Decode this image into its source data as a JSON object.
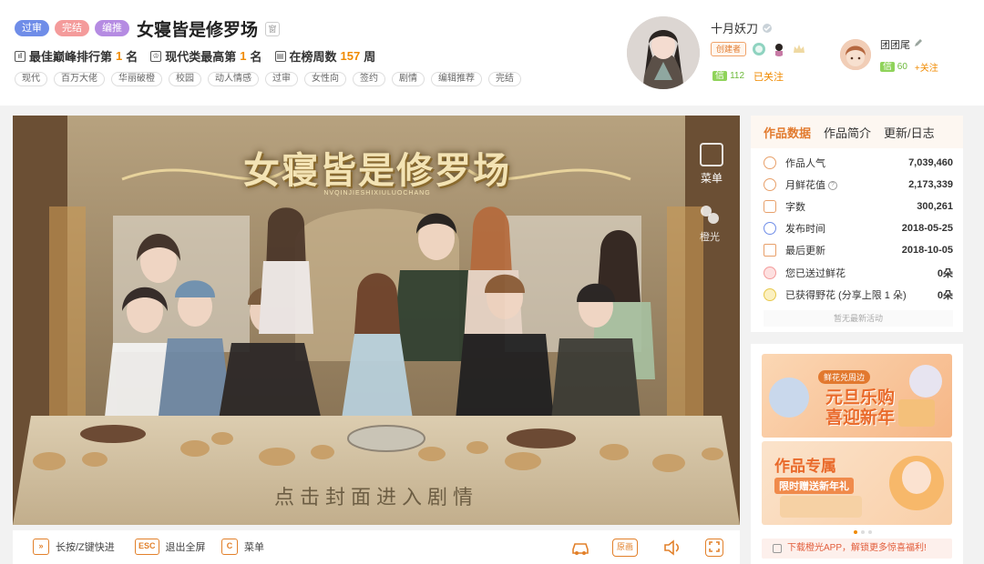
{
  "header": {
    "badges": [
      "过审",
      "完结",
      "编推"
    ],
    "title": "女寝皆是修罗场",
    "title_icon": "窗",
    "ranks": [
      {
        "prefix": "最佳巅峰排行第",
        "num": "1",
        "suffix": "名",
        "icon": "bar-chart-icon"
      },
      {
        "prefix": "现代类最高第",
        "num": "1",
        "suffix": "名",
        "icon": "trophy-icon"
      },
      {
        "prefix": "在榜周数 ",
        "num": "157",
        "suffix": " 周",
        "icon": "calendar-icon"
      }
    ],
    "tags": [
      "现代",
      "百万大佬",
      "华丽破橙",
      "校园",
      "动人情感",
      "过审",
      "女性向",
      "签约",
      "剧情",
      "编辑推荐",
      "完结"
    ]
  },
  "author": {
    "name": "十月妖刀",
    "creator_badge": "创建者",
    "xin_label": "信",
    "xin_value": "112",
    "followed_label": "已关注"
  },
  "fan": {
    "name": "团团尾",
    "xin_label": "信",
    "xin_value": "60",
    "follow_label": "+关注"
  },
  "game": {
    "title_art": "女寝皆是修罗场",
    "subtitle_art": "NVQINJIESHIXIULUOCHANG",
    "menu_label": "菜单",
    "brand_label": "橙光",
    "enter_text": "点击封面进入剧情"
  },
  "controls": {
    "fast_forward": {
      "key": "»",
      "label": "长按/Z键快进"
    },
    "exit_fullscreen": {
      "key": "ESC",
      "label": "退出全屏"
    },
    "menu": {
      "key": "C",
      "label": "菜单"
    },
    "original_painting": "原画"
  },
  "panel": {
    "tabs": [
      "作品数据",
      "作品简介",
      "更新/日志"
    ],
    "active_tab": 0,
    "stats": [
      {
        "label": "作品人气",
        "value": "7,039,460",
        "icon": "fire-icon"
      },
      {
        "label": "月鲜花值",
        "value": "2,173,339",
        "icon": "flower-pot-icon",
        "help": "?"
      },
      {
        "label": "字数",
        "value": "300,261",
        "icon": "text-icon"
      },
      {
        "label": "发布时间",
        "value": "2018-05-25",
        "icon": "clock-icon"
      },
      {
        "label": "最后更新",
        "value": "2018-10-05",
        "icon": "pencil-icon"
      },
      {
        "label": "您已送过鲜花",
        "value": "0朵",
        "icon": "flower-icon"
      },
      {
        "label": "已获得野花 (分享上限 1 朵)",
        "value": "0朵",
        "icon": "wild-flower-icon"
      }
    ],
    "no_activity": "暂无最新活动"
  },
  "ads": {
    "ad1_kicker": "鲜花兑周边",
    "ad1_headline_1": "元旦乐购",
    "ad1_headline_2": "喜迎新年",
    "ad2_headline": "作品专属",
    "ad2_sub": "限时赠送新年礼",
    "app_bar": "下载橙光APP，解锁更多惊喜福利!"
  },
  "colors": {
    "accent": "#e27b2f",
    "badge_blue": "#6f8de8",
    "badge_pink": "#f49b9b",
    "badge_purple": "#b58be2",
    "xin_green": "#8fd35a"
  }
}
